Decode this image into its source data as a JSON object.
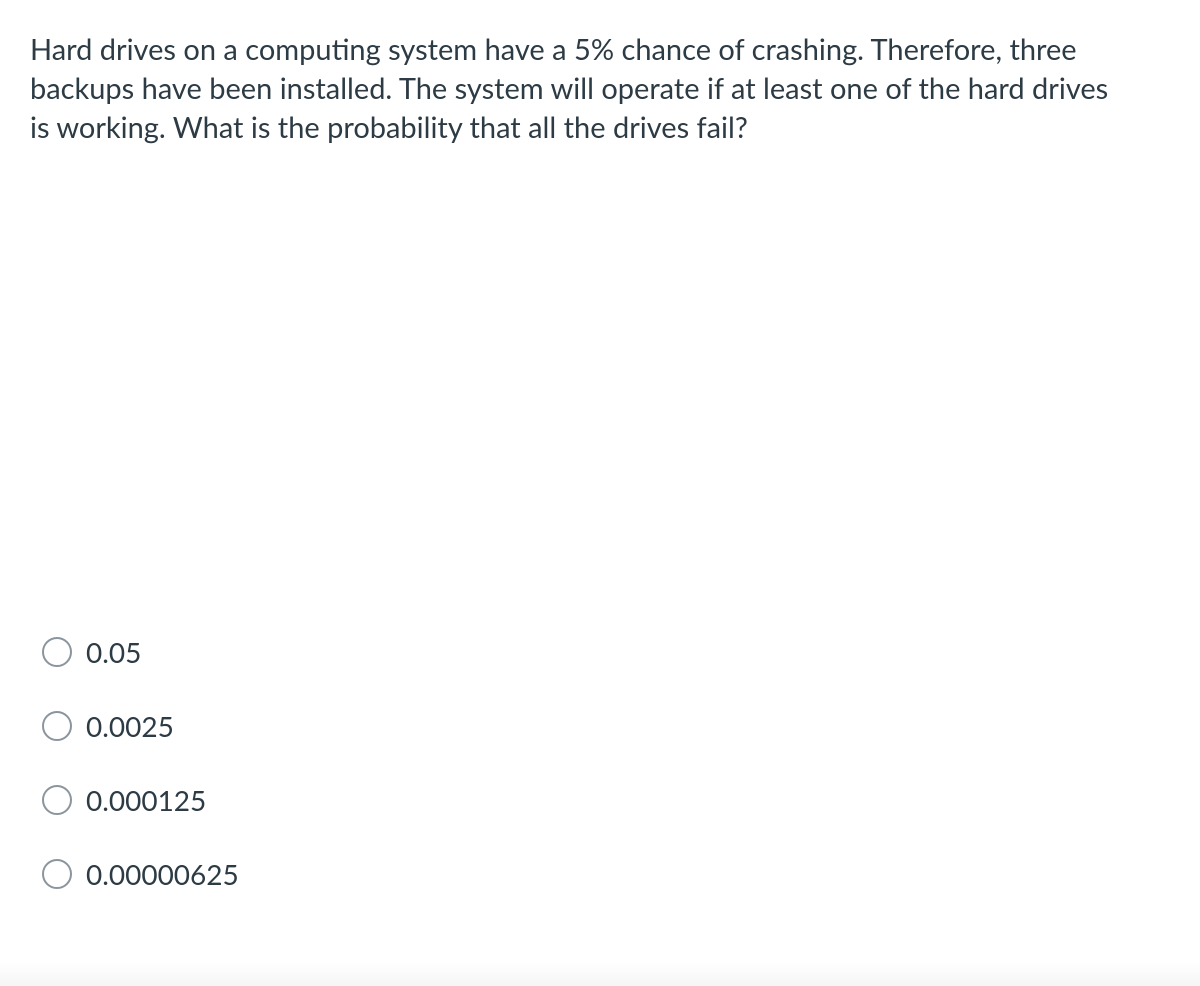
{
  "question": {
    "text": "Hard drives on a computing system have a 5% chance of crashing. Therefore, three backups have been installed. The system will operate if at least one of the hard drives is working. What is the probability that all the drives fail?"
  },
  "options": [
    {
      "label": "0.05"
    },
    {
      "label": "0.0025"
    },
    {
      "label": "0.000125"
    },
    {
      "label": "0.00000625"
    }
  ]
}
